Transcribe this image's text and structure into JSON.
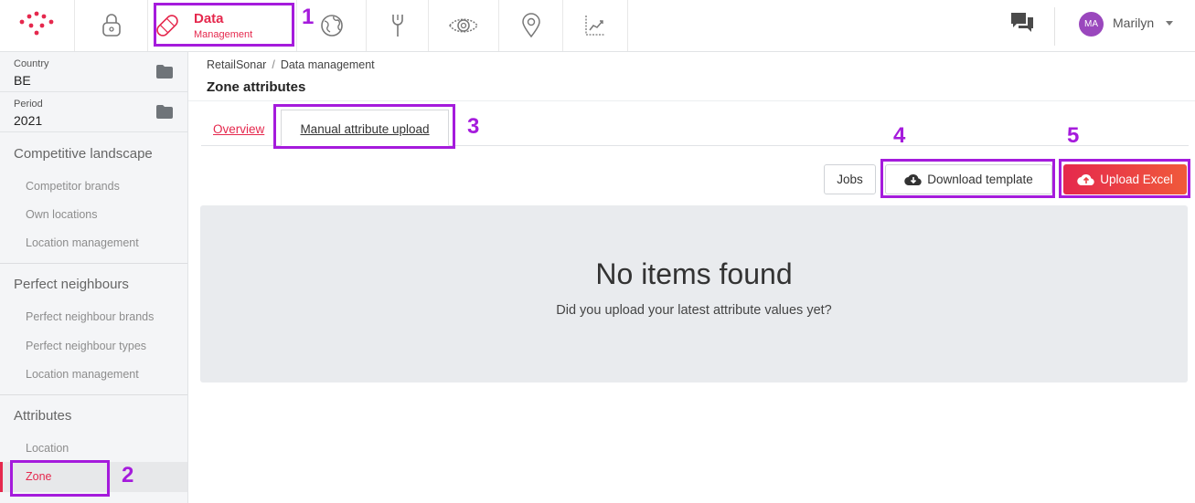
{
  "topnav": {
    "active_item": {
      "title": "Data",
      "subtitle": "Management"
    },
    "user": {
      "initials": "MA",
      "name": "Marilyn"
    }
  },
  "sidebar": {
    "country": {
      "label": "Country",
      "value": "BE"
    },
    "period": {
      "label": "Period",
      "value": "2021"
    },
    "sections": [
      {
        "title": "Competitive landscape",
        "items": [
          "Competitor brands",
          "Own locations",
          "Location management"
        ]
      },
      {
        "title": "Perfect neighbours",
        "items": [
          "Perfect neighbour brands",
          "Perfect neighbour types",
          "Location management"
        ]
      },
      {
        "title": "Attributes",
        "items": [
          "Location",
          "Zone"
        ]
      }
    ]
  },
  "breadcrumb": {
    "root": "RetailSonar",
    "current": "Data management"
  },
  "page": {
    "title": "Zone attributes"
  },
  "tabs": [
    {
      "label": "Overview"
    },
    {
      "label": "Manual attribute upload"
    }
  ],
  "actions": {
    "jobs": "Jobs",
    "download_template": "Download template",
    "upload_excel": "Upload Excel"
  },
  "empty_state": {
    "title": "No items found",
    "subtitle": "Did you upload your latest attribute values yet?"
  },
  "annotations": [
    "1",
    "2",
    "3",
    "4",
    "5"
  ],
  "colors": {
    "accent": "#e5284d",
    "annotation": "#a51bdc",
    "avatar": "#9a47bd"
  }
}
